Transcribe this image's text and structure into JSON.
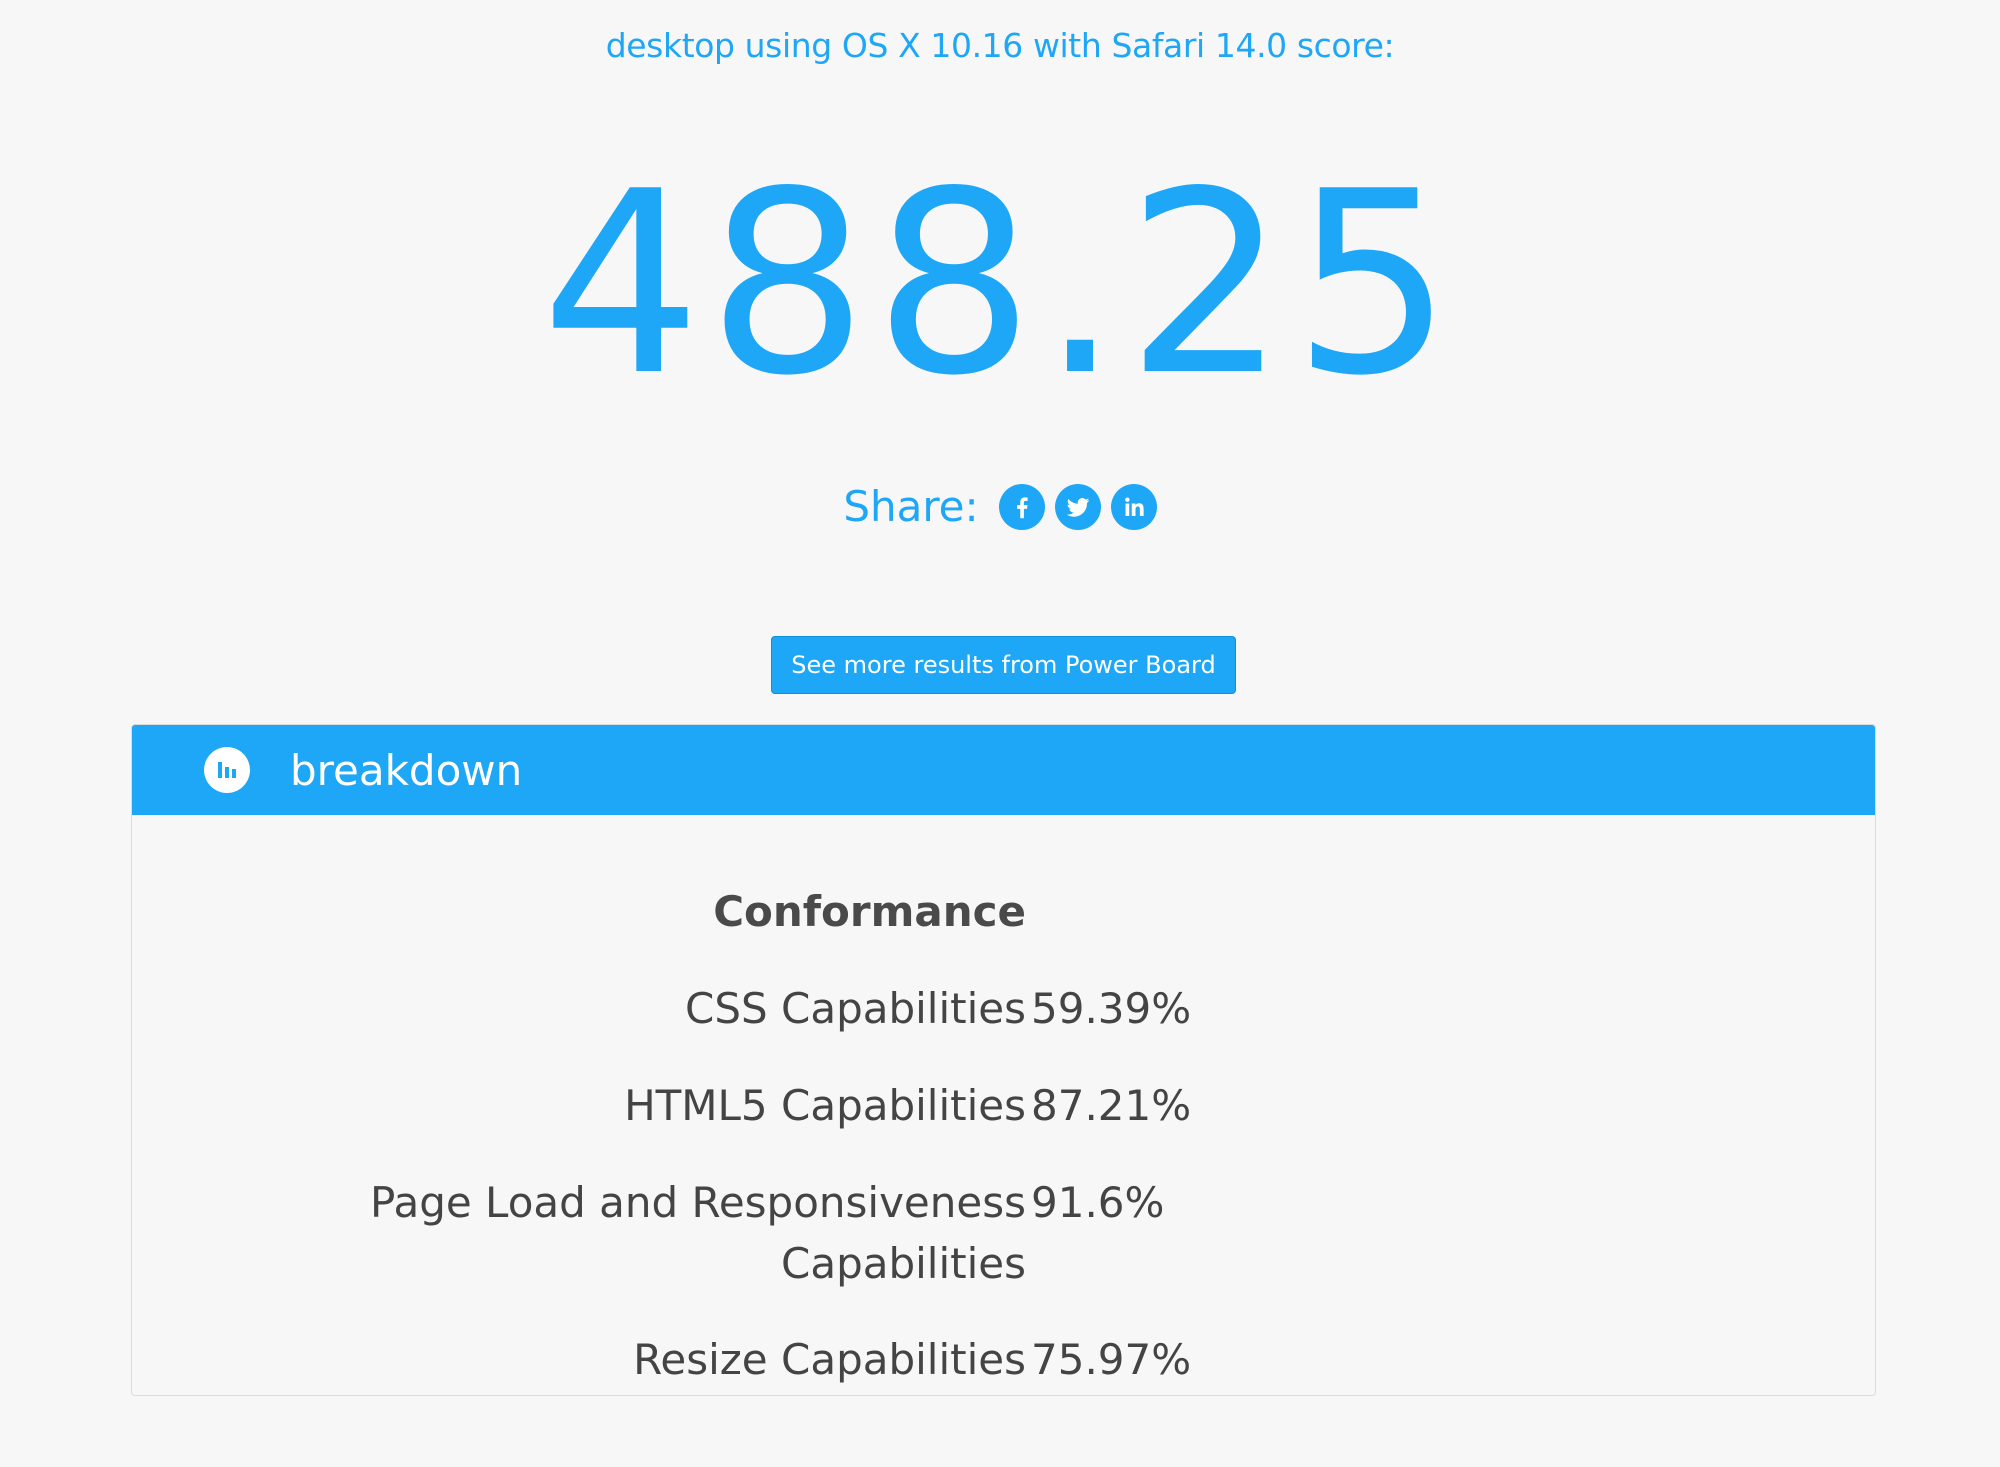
{
  "subtitle": "desktop using OS X 10.16 with Safari 14.0 score:",
  "score": "488.25",
  "share": {
    "label": "Share:",
    "icons": [
      "facebook-icon",
      "twitter-icon",
      "linkedin-icon"
    ]
  },
  "more_button_label": "See more results from Power Board",
  "breakdown": {
    "title": "breakdown",
    "section_heading": "Conformance",
    "rows": [
      {
        "label": "CSS Capabilities",
        "value": "59.39%"
      },
      {
        "label": "HTML5 Capabilities",
        "value": "87.21%"
      },
      {
        "label": "Page Load and Responsiveness Capabilities",
        "value": "91.6%"
      },
      {
        "label": "Resize Capabilities",
        "value": "75.97%"
      }
    ]
  },
  "colors": {
    "accent": "#1ea6f7",
    "background": "#f7f7f7",
    "text": "#444444"
  }
}
